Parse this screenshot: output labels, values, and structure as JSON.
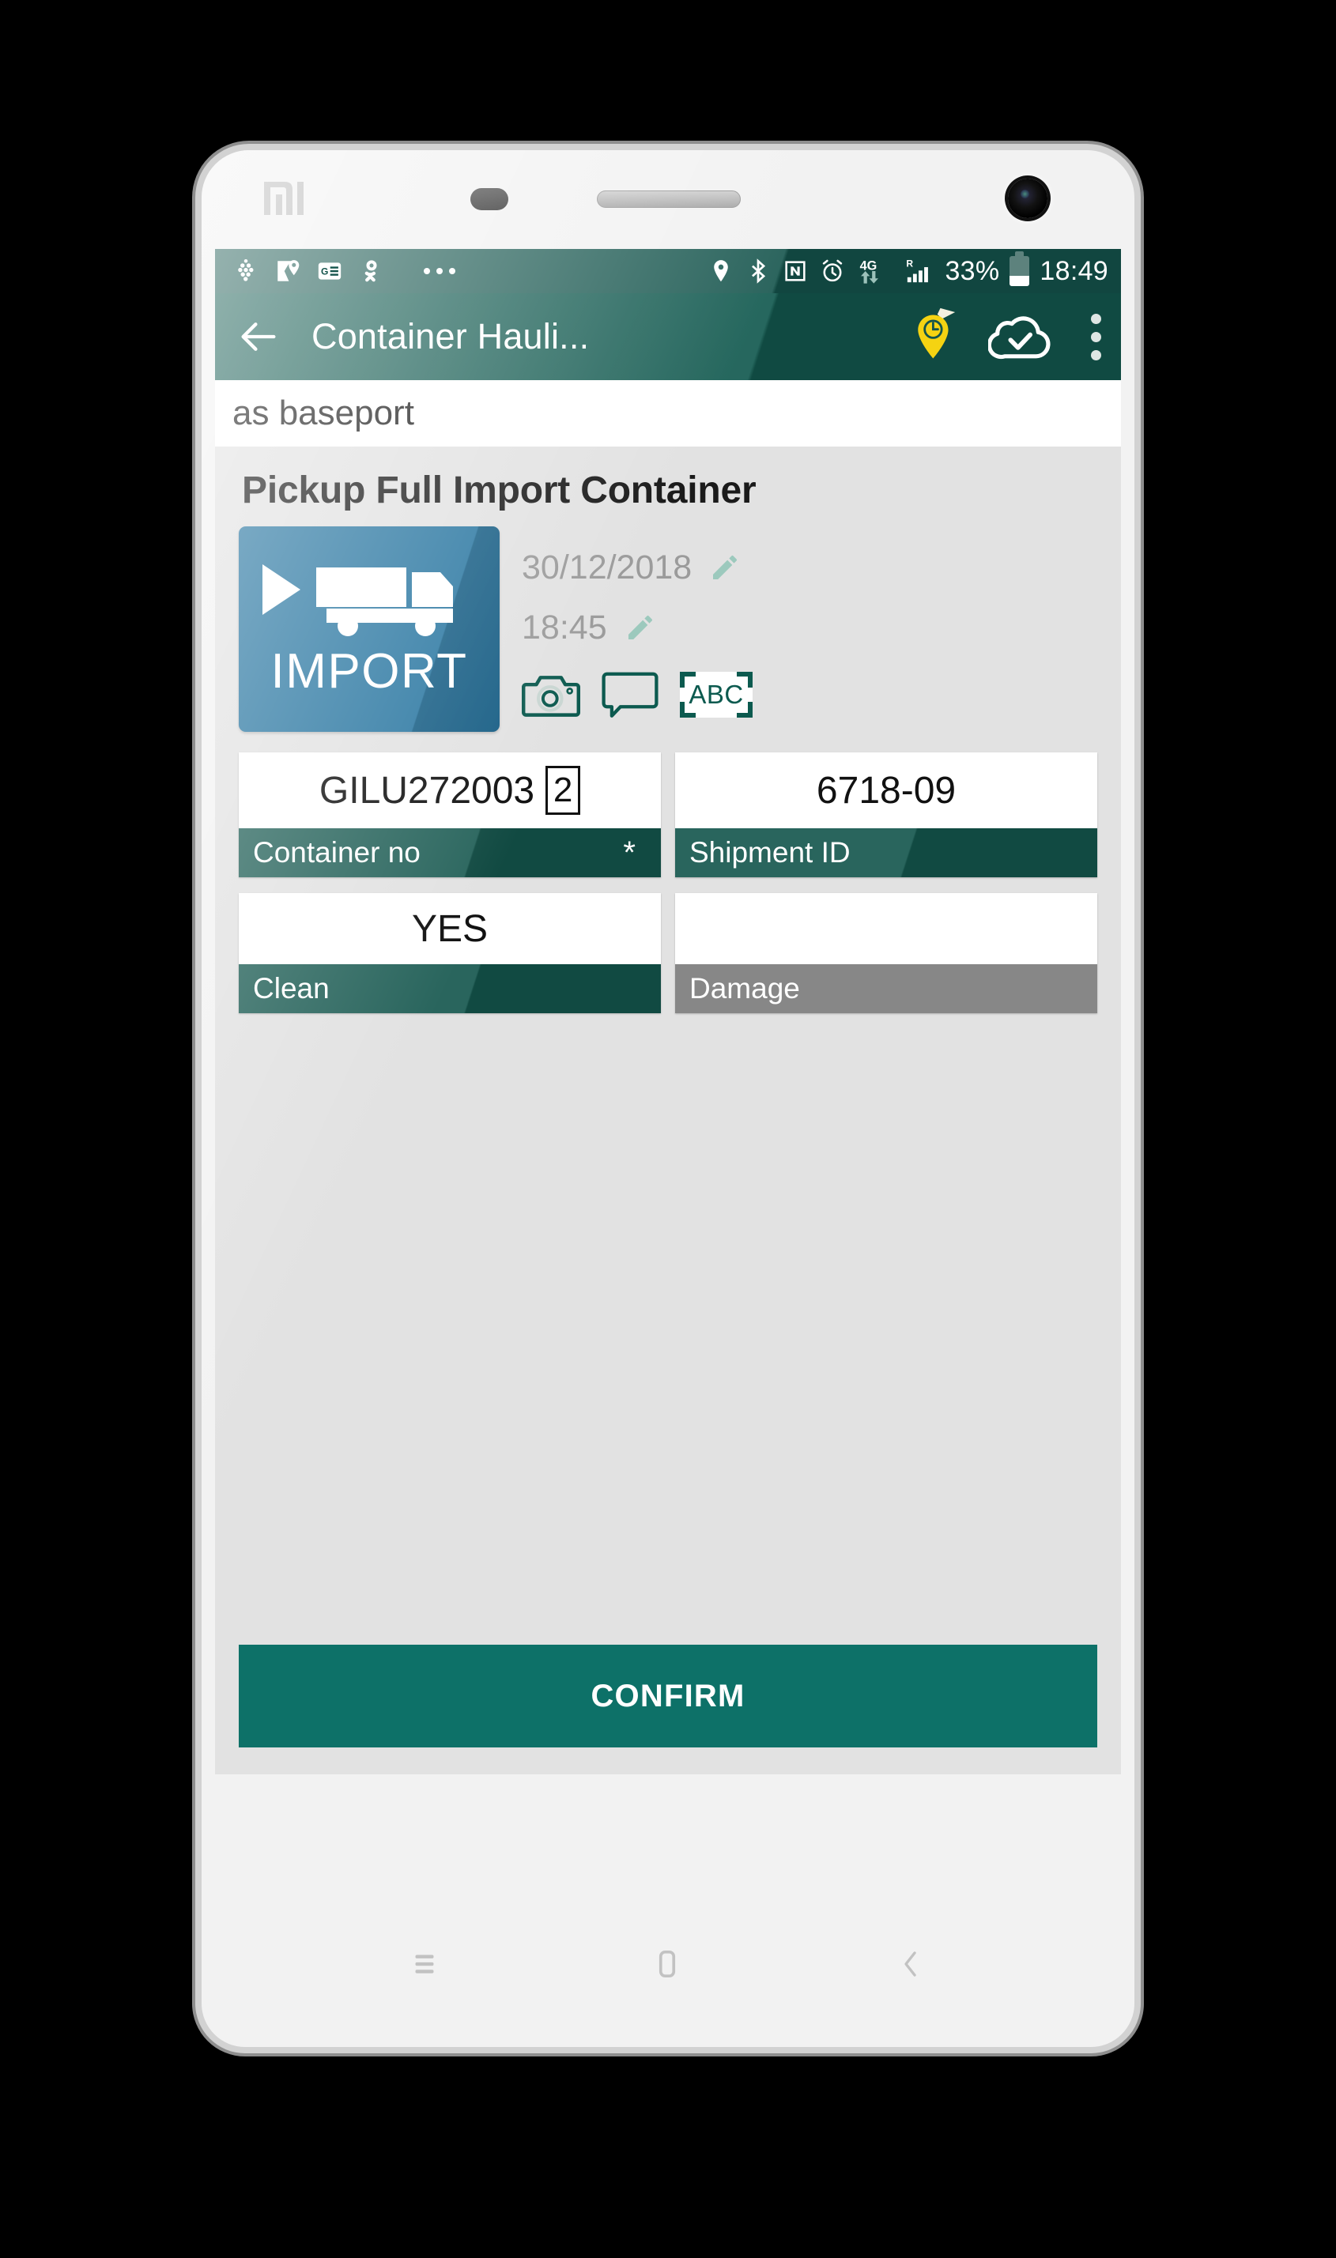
{
  "device": {
    "brand_logo": "mi-logo",
    "sensor": "proximity-sensor",
    "speaker": "earpiece-speaker",
    "camera": "front-camera"
  },
  "status_bar": {
    "background": "#14544c",
    "notification_icons": [
      "grapes-icon",
      "google-maps-icon",
      "google-news-icon",
      "odnoklassniki-icon"
    ],
    "overflow": "more-notifications-dots",
    "system_icons": [
      "location-icon",
      "bluetooth-icon",
      "nfc-icon",
      "alarm-icon",
      "4g-data-icon",
      "roaming-icon",
      "signal-bars-icon"
    ],
    "network_label": "4G",
    "roaming_label": "R",
    "battery_percent": "33%",
    "battery_level": 33,
    "clock": "18:49"
  },
  "app_bar": {
    "background": "#135a50",
    "back_icon": "arrow-back-icon",
    "title": "Container Hauli...",
    "pin_clock_icon": "map-pin-clock-icon",
    "pin_color": "#f5d312",
    "cloud_icon": "cloud-check-icon",
    "overflow_icon": "kebab-menu-icon"
  },
  "subtitle": {
    "text": "as baseport"
  },
  "main": {
    "title": "Pickup Full Import Container",
    "tile": {
      "label": "IMPORT",
      "icon": "truck-import-icon",
      "color": "#1c6e9b"
    },
    "date": {
      "value": "30/12/2018",
      "edit_icon": "pencil-icon"
    },
    "time": {
      "value": "18:45",
      "edit_icon": "pencil-icon"
    },
    "actions": [
      {
        "name": "camera-icon",
        "label": ""
      },
      {
        "name": "comment-icon",
        "label": ""
      },
      {
        "name": "abc-scan-icon",
        "label": "ABC"
      }
    ],
    "fields": [
      {
        "label": "Container no",
        "value": "GILU272003",
        "check_digit": "2",
        "required": "*",
        "label_style": "teal"
      },
      {
        "label": "Shipment ID",
        "value": "6718-09",
        "check_digit": "",
        "required": "",
        "label_style": "teal"
      },
      {
        "label": "Clean",
        "value": "YES",
        "check_digit": "",
        "required": "",
        "label_style": "teal"
      },
      {
        "label": "Damage",
        "value": "",
        "check_digit": "",
        "required": "",
        "label_style": "gray"
      }
    ],
    "confirm_label": "CONFIRM",
    "confirm_color": "#0d7168"
  },
  "nav_bar": {
    "menu_icon": "menu-icon",
    "home_icon": "home-icon",
    "back_icon": "back-chevron-icon"
  }
}
